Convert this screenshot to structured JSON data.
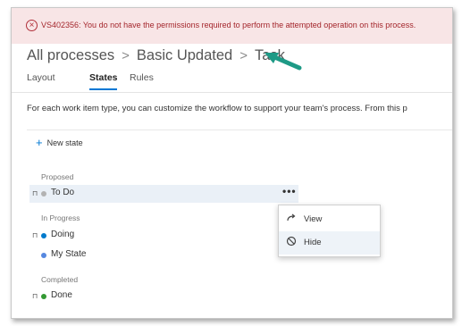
{
  "banner": {
    "icon": "error-circle-icon",
    "message": "VS402356: You do not have the permissions required to perform the attempted operation on this process."
  },
  "breadcrumb": {
    "items": [
      "All processes",
      "Basic Updated",
      "Task"
    ],
    "separator": ">"
  },
  "tabs": [
    {
      "label": "Layout",
      "active": false
    },
    {
      "label": "States",
      "active": true
    },
    {
      "label": "Rules",
      "active": false
    }
  ],
  "description": "For each work item type, you can customize the workflow to support your team's process. From this p",
  "toolbar": {
    "new_state_label": "New state"
  },
  "categories": [
    {
      "label": "Proposed",
      "states": [
        {
          "label": "To Do",
          "color": "#b2b2b2"
        }
      ]
    },
    {
      "label": "In Progress",
      "states": [
        {
          "label": "Doing",
          "color": "#007acc"
        },
        {
          "label": "My State",
          "color": "#5688e0"
        }
      ]
    },
    {
      "label": "Completed",
      "states": [
        {
          "label": "Done",
          "color": "#339933"
        }
      ]
    }
  ],
  "row_actions": {
    "more_label": "•••"
  },
  "context_menu": {
    "items": [
      {
        "label": "View",
        "icon": "redo-arrow-icon"
      },
      {
        "label": "Hide",
        "icon": "prohibited-icon"
      }
    ]
  },
  "colors": {
    "banner_bg": "#f8e5e6",
    "banner_text": "#a4262c",
    "accent": "#0078d4",
    "arrow": "#1e9a86"
  }
}
